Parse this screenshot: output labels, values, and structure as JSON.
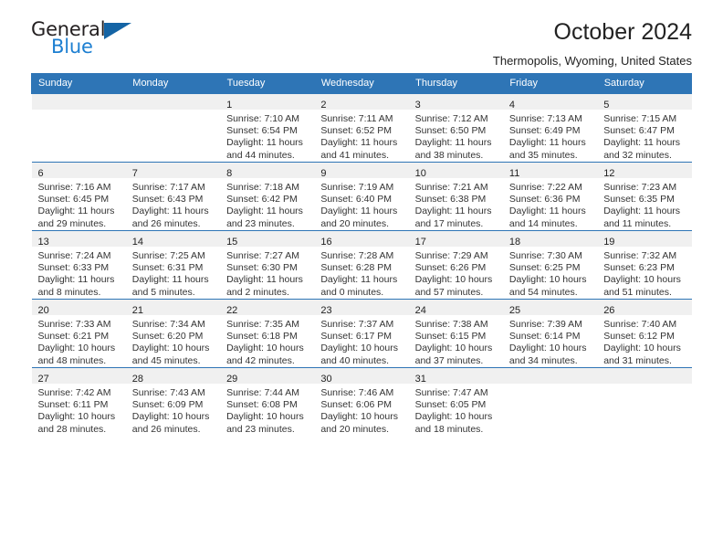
{
  "brand": {
    "name_top": "General",
    "name_bottom": "Blue",
    "accent_color": "#1d7fd1",
    "triangle_color": "#1464a5"
  },
  "header": {
    "title": "October 2024",
    "subtitle": "Thermopolis, Wyoming, United States"
  },
  "theme": {
    "header_blue": "#2e75b6",
    "cell_band_gray": "#f0f0f0",
    "text_color": "#333333"
  },
  "calendar": {
    "weekdays": [
      "Sunday",
      "Monday",
      "Tuesday",
      "Wednesday",
      "Thursday",
      "Friday",
      "Saturday"
    ],
    "weeks": [
      [
        {
          "day": "",
          "lines": []
        },
        {
          "day": "",
          "lines": []
        },
        {
          "day": "1",
          "lines": [
            "Sunrise: 7:10 AM",
            "Sunset: 6:54 PM",
            "Daylight: 11 hours",
            "and 44 minutes."
          ]
        },
        {
          "day": "2",
          "lines": [
            "Sunrise: 7:11 AM",
            "Sunset: 6:52 PM",
            "Daylight: 11 hours",
            "and 41 minutes."
          ]
        },
        {
          "day": "3",
          "lines": [
            "Sunrise: 7:12 AM",
            "Sunset: 6:50 PM",
            "Daylight: 11 hours",
            "and 38 minutes."
          ]
        },
        {
          "day": "4",
          "lines": [
            "Sunrise: 7:13 AM",
            "Sunset: 6:49 PM",
            "Daylight: 11 hours",
            "and 35 minutes."
          ]
        },
        {
          "day": "5",
          "lines": [
            "Sunrise: 7:15 AM",
            "Sunset: 6:47 PM",
            "Daylight: 11 hours",
            "and 32 minutes."
          ]
        }
      ],
      [
        {
          "day": "6",
          "lines": [
            "Sunrise: 7:16 AM",
            "Sunset: 6:45 PM",
            "Daylight: 11 hours",
            "and 29 minutes."
          ]
        },
        {
          "day": "7",
          "lines": [
            "Sunrise: 7:17 AM",
            "Sunset: 6:43 PM",
            "Daylight: 11 hours",
            "and 26 minutes."
          ]
        },
        {
          "day": "8",
          "lines": [
            "Sunrise: 7:18 AM",
            "Sunset: 6:42 PM",
            "Daylight: 11 hours",
            "and 23 minutes."
          ]
        },
        {
          "day": "9",
          "lines": [
            "Sunrise: 7:19 AM",
            "Sunset: 6:40 PM",
            "Daylight: 11 hours",
            "and 20 minutes."
          ]
        },
        {
          "day": "10",
          "lines": [
            "Sunrise: 7:21 AM",
            "Sunset: 6:38 PM",
            "Daylight: 11 hours",
            "and 17 minutes."
          ]
        },
        {
          "day": "11",
          "lines": [
            "Sunrise: 7:22 AM",
            "Sunset: 6:36 PM",
            "Daylight: 11 hours",
            "and 14 minutes."
          ]
        },
        {
          "day": "12",
          "lines": [
            "Sunrise: 7:23 AM",
            "Sunset: 6:35 PM",
            "Daylight: 11 hours",
            "and 11 minutes."
          ]
        }
      ],
      [
        {
          "day": "13",
          "lines": [
            "Sunrise: 7:24 AM",
            "Sunset: 6:33 PM",
            "Daylight: 11 hours",
            "and 8 minutes."
          ]
        },
        {
          "day": "14",
          "lines": [
            "Sunrise: 7:25 AM",
            "Sunset: 6:31 PM",
            "Daylight: 11 hours",
            "and 5 minutes."
          ]
        },
        {
          "day": "15",
          "lines": [
            "Sunrise: 7:27 AM",
            "Sunset: 6:30 PM",
            "Daylight: 11 hours",
            "and 2 minutes."
          ]
        },
        {
          "day": "16",
          "lines": [
            "Sunrise: 7:28 AM",
            "Sunset: 6:28 PM",
            "Daylight: 11 hours",
            "and 0 minutes."
          ]
        },
        {
          "day": "17",
          "lines": [
            "Sunrise: 7:29 AM",
            "Sunset: 6:26 PM",
            "Daylight: 10 hours",
            "and 57 minutes."
          ]
        },
        {
          "day": "18",
          "lines": [
            "Sunrise: 7:30 AM",
            "Sunset: 6:25 PM",
            "Daylight: 10 hours",
            "and 54 minutes."
          ]
        },
        {
          "day": "19",
          "lines": [
            "Sunrise: 7:32 AM",
            "Sunset: 6:23 PM",
            "Daylight: 10 hours",
            "and 51 minutes."
          ]
        }
      ],
      [
        {
          "day": "20",
          "lines": [
            "Sunrise: 7:33 AM",
            "Sunset: 6:21 PM",
            "Daylight: 10 hours",
            "and 48 minutes."
          ]
        },
        {
          "day": "21",
          "lines": [
            "Sunrise: 7:34 AM",
            "Sunset: 6:20 PM",
            "Daylight: 10 hours",
            "and 45 minutes."
          ]
        },
        {
          "day": "22",
          "lines": [
            "Sunrise: 7:35 AM",
            "Sunset: 6:18 PM",
            "Daylight: 10 hours",
            "and 42 minutes."
          ]
        },
        {
          "day": "23",
          "lines": [
            "Sunrise: 7:37 AM",
            "Sunset: 6:17 PM",
            "Daylight: 10 hours",
            "and 40 minutes."
          ]
        },
        {
          "day": "24",
          "lines": [
            "Sunrise: 7:38 AM",
            "Sunset: 6:15 PM",
            "Daylight: 10 hours",
            "and 37 minutes."
          ]
        },
        {
          "day": "25",
          "lines": [
            "Sunrise: 7:39 AM",
            "Sunset: 6:14 PM",
            "Daylight: 10 hours",
            "and 34 minutes."
          ]
        },
        {
          "day": "26",
          "lines": [
            "Sunrise: 7:40 AM",
            "Sunset: 6:12 PM",
            "Daylight: 10 hours",
            "and 31 minutes."
          ]
        }
      ],
      [
        {
          "day": "27",
          "lines": [
            "Sunrise: 7:42 AM",
            "Sunset: 6:11 PM",
            "Daylight: 10 hours",
            "and 28 minutes."
          ]
        },
        {
          "day": "28",
          "lines": [
            "Sunrise: 7:43 AM",
            "Sunset: 6:09 PM",
            "Daylight: 10 hours",
            "and 26 minutes."
          ]
        },
        {
          "day": "29",
          "lines": [
            "Sunrise: 7:44 AM",
            "Sunset: 6:08 PM",
            "Daylight: 10 hours",
            "and 23 minutes."
          ]
        },
        {
          "day": "30",
          "lines": [
            "Sunrise: 7:46 AM",
            "Sunset: 6:06 PM",
            "Daylight: 10 hours",
            "and 20 minutes."
          ]
        },
        {
          "day": "31",
          "lines": [
            "Sunrise: 7:47 AM",
            "Sunset: 6:05 PM",
            "Daylight: 10 hours",
            "and 18 minutes."
          ]
        },
        {
          "day": "",
          "lines": []
        },
        {
          "day": "",
          "lines": []
        }
      ]
    ]
  }
}
